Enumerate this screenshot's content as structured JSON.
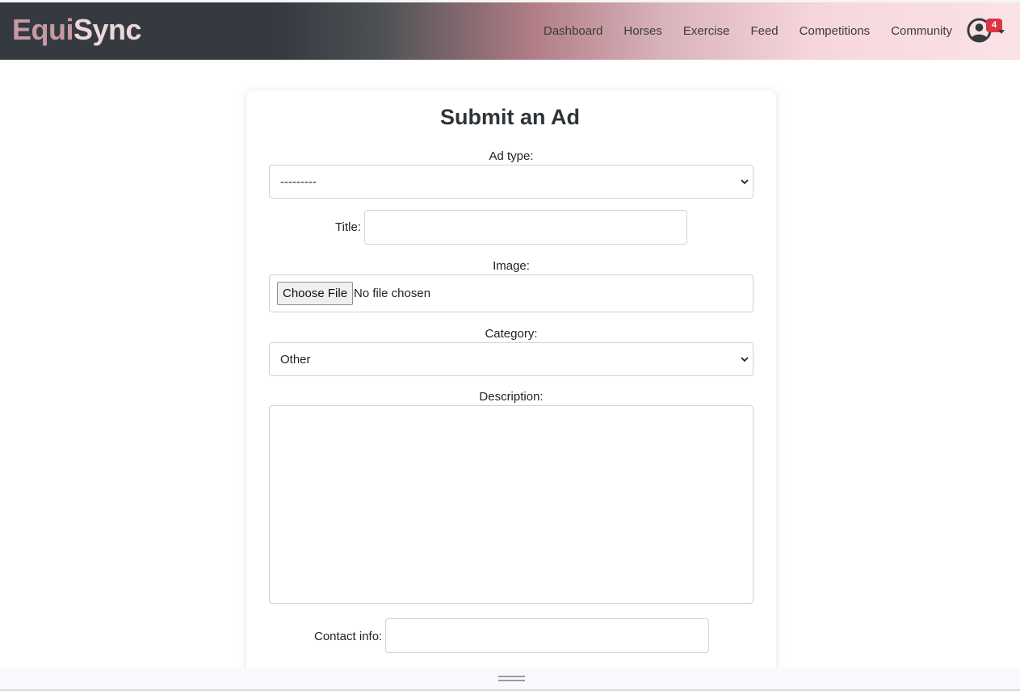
{
  "brand": {
    "part1": "Equi",
    "part2": "Sync"
  },
  "nav": {
    "links": [
      "Dashboard",
      "Horses",
      "Exercise",
      "Feed",
      "Competitions",
      "Community"
    ]
  },
  "user": {
    "icon": "user-circle-icon",
    "notification_count": "4"
  },
  "form": {
    "title": "Submit an Ad",
    "ad_type": {
      "label": "Ad type:",
      "selected": "---------"
    },
    "title_field": {
      "label": "Title:",
      "value": ""
    },
    "image": {
      "label": "Image:",
      "button": "Choose File",
      "status": "No file chosen"
    },
    "category": {
      "label": "Category:",
      "selected": "Other"
    },
    "description": {
      "label": "Description:",
      "value": ""
    },
    "contact": {
      "label": "Contact info:",
      "value": ""
    }
  },
  "colors": {
    "navbar_dark": "#343a40",
    "navbar_pink": "#f6d6dc",
    "brand_accent": "#c89aa3",
    "badge": "#dc3545"
  }
}
